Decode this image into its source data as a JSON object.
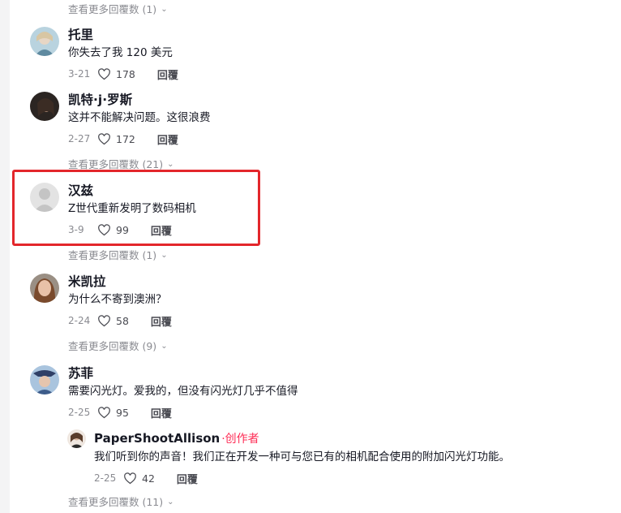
{
  "more_replies": [
    {
      "label": "查看更多回覆数 (1)"
    },
    {
      "label": "查看更多回覆数 (21)"
    },
    {
      "label": "查看更多回覆数 (1)"
    },
    {
      "label": "查看更多回覆数 (9)"
    },
    {
      "label": "查看更多回覆数 (11)"
    }
  ],
  "comments": [
    {
      "name": "托里",
      "text": "你失去了我 120 美元",
      "date": "3-21",
      "likes": "178",
      "reply_label": "回覆"
    },
    {
      "name": "凯特·j·罗斯",
      "text": "这并不能解决问题。这很浪费",
      "date": "2-27",
      "likes": "172",
      "reply_label": "回覆"
    },
    {
      "name": "汉兹",
      "text": "Z世代重新发明了数码相机",
      "date": "3-9",
      "likes": "99",
      "reply_label": "回覆"
    },
    {
      "name": "米凯拉",
      "text": "为什么不寄到澳洲？",
      "date": "2-24",
      "likes": "58",
      "reply_label": "回覆"
    },
    {
      "name": "苏菲",
      "text": "需要闪光灯。爱我的，但没有闪光灯几乎不值得",
      "date": "2-25",
      "likes": "95",
      "reply_label": "回覆"
    }
  ],
  "creator_reply": {
    "name": "PaperShootAllison",
    "badge": "·创作者",
    "text": "我们听到你的声音！我们正在开发一种可与您已有的相机配合使用的附加闪光灯功能。",
    "date": "2-25",
    "likes": "42",
    "reply_label": "回覆"
  },
  "colors": {
    "highlight_box": "#e3262b",
    "creator_badge": "#fe2c55",
    "muted_text": "#8a8b91"
  }
}
